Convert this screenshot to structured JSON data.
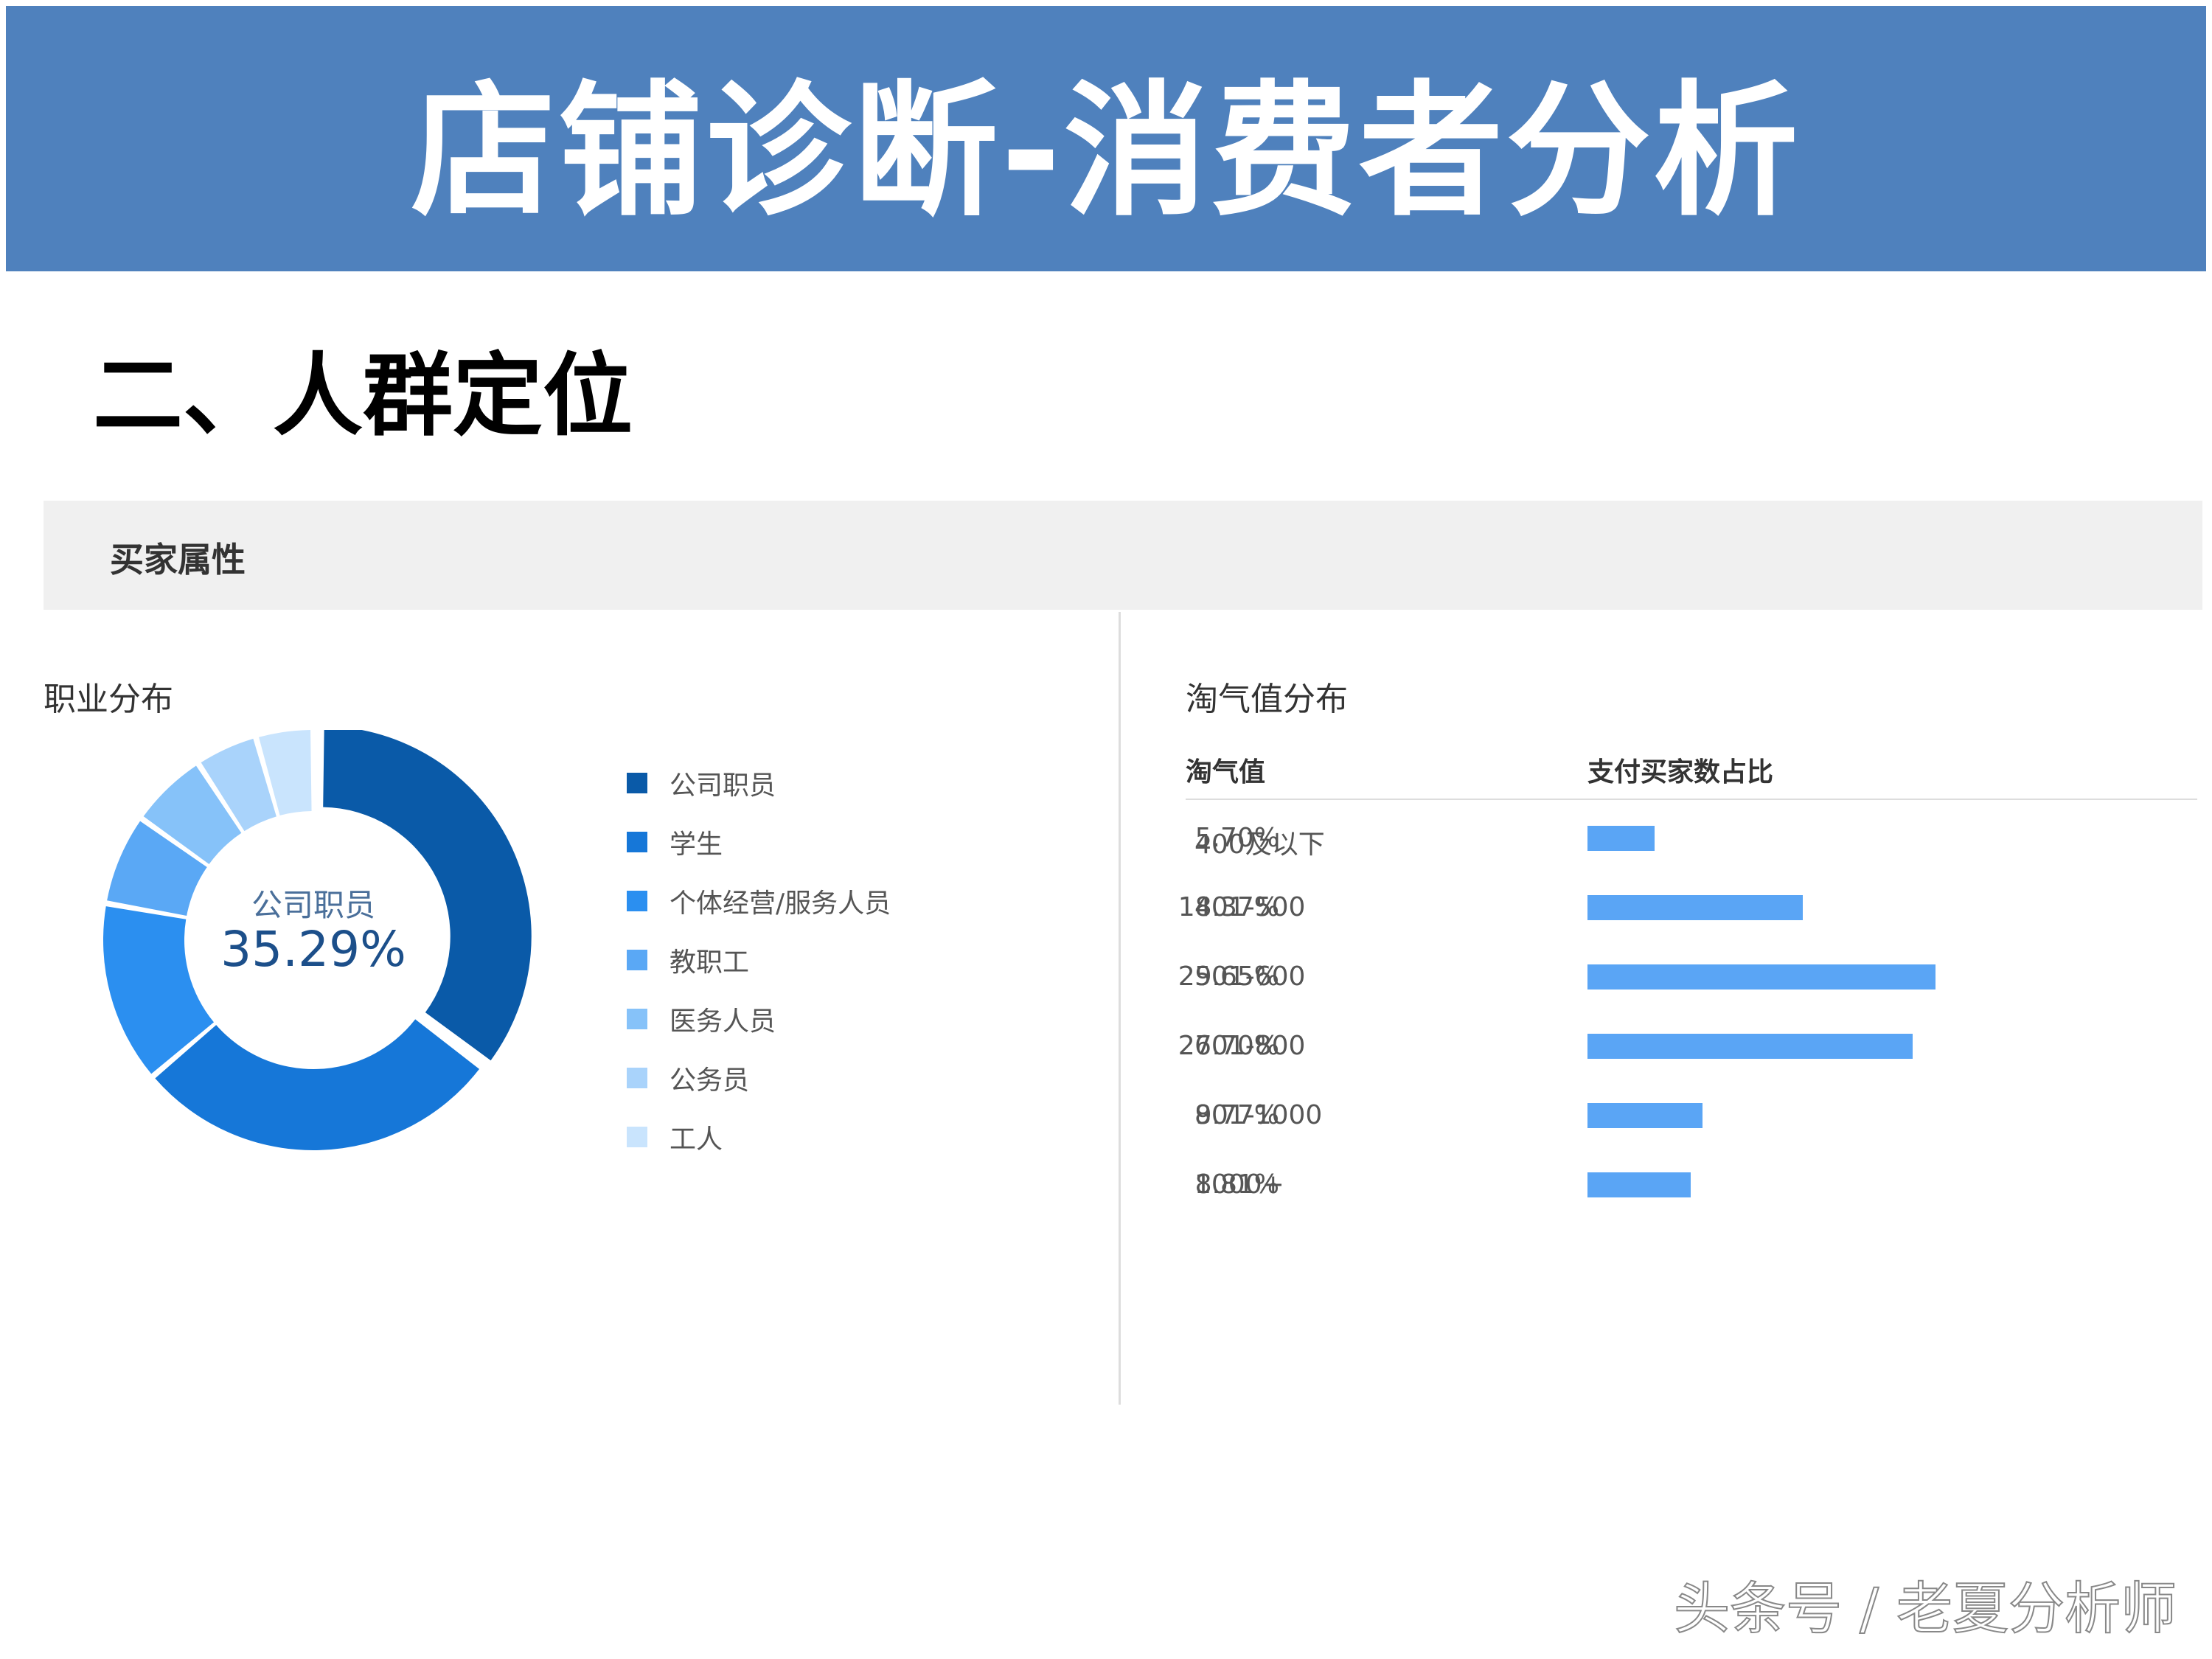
{
  "banner": {
    "title": "店铺诊断-消费者分析"
  },
  "section": {
    "heading": "二、人群定位"
  },
  "panel": {
    "title": "买家属性"
  },
  "occupation": {
    "title": "职业分布",
    "center_label": "公司职员",
    "center_value": "35.29%"
  },
  "taoqi": {
    "title": "淘气值分布",
    "col_value": "淘气值",
    "col_ratio": "支付买家数占比"
  },
  "colors": {
    "banner": "#4f81bd",
    "bar": "#5aa5f5",
    "donut": [
      "#0a5aa8",
      "#1677d8",
      "#2b8ff0",
      "#5aa8f5",
      "#86c2f9",
      "#a9d3fb",
      "#c9e4fd"
    ]
  },
  "chart_data": [
    {
      "type": "pie",
      "title": "职业分布",
      "categories": [
        "公司职员",
        "学生",
        "个体经营/服务人员",
        "教职工",
        "医务人员",
        "公务员",
        "工人"
      ],
      "values": [
        35.29,
        28.5,
        14.0,
        7.0,
        6.0,
        4.8,
        4.4
      ],
      "legend": "right"
    },
    {
      "type": "bar",
      "title": "淘气值分布",
      "categories": [
        "400及以下",
        "401-500",
        "501-600",
        "601-800",
        "801-1000",
        "1000+"
      ],
      "values": [
        5.7,
        18.37,
        29.65,
        27.7,
        9.77,
        8.81
      ],
      "labels": [
        "5.70%",
        "18.37%",
        "29.65%",
        "27.70%",
        "9.77%",
        "8.81%"
      ],
      "xlim": [
        0,
        100
      ],
      "orientation": "horizontal"
    }
  ],
  "watermark": "头条号 / 老夏分析师"
}
